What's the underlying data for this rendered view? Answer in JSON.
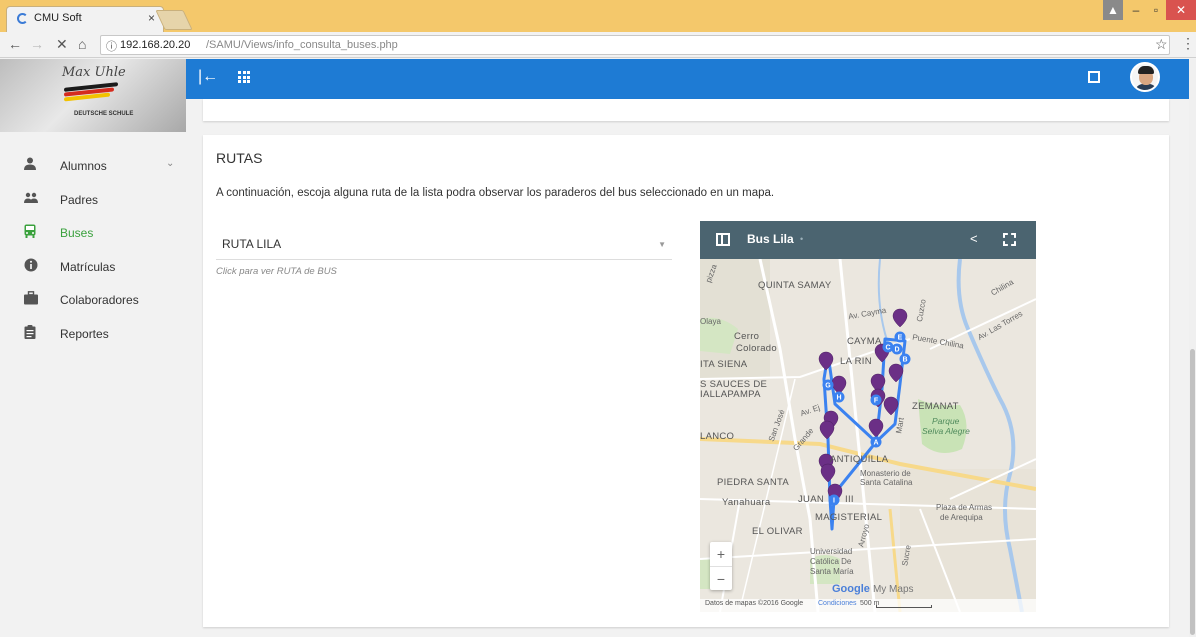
{
  "browser": {
    "tab_title": "CMU Soft",
    "tab_close": "×",
    "url_host": "192.168.20.20",
    "url_path": "/SAMU/Views/info_consulta_buses.php",
    "nav": {
      "back": "←",
      "forward": "→",
      "stop": "✕",
      "home": "⌂"
    },
    "star": "☆",
    "menu": "⋮",
    "window_buttons": {
      "minimize": "–",
      "maximize": "▫",
      "close": "✕"
    }
  },
  "logo": {
    "name": "Max Uhle",
    "subtitle": "DEUTSCHE SCHULE"
  },
  "sidebar": {
    "items": [
      {
        "label": "Alumnos",
        "icon": "person-icon",
        "has_submenu": true
      },
      {
        "label": "Padres",
        "icon": "group-icon"
      },
      {
        "label": "Buses",
        "icon": "bus-icon",
        "active": true
      },
      {
        "label": "Matrículas",
        "icon": "info-icon"
      },
      {
        "label": "Colaboradores",
        "icon": "briefcase-icon"
      },
      {
        "label": "Reportes",
        "icon": "clipboard-icon"
      }
    ],
    "chevron": "⌄"
  },
  "header": {
    "back_icon": "|←",
    "accent_color": "#1e7bd4"
  },
  "content": {
    "title": "RUTAS",
    "description": "A continuación, escoja alguna ruta de la lista podra observar los paraderos del bus seleccionado en un mapa.",
    "route_select": {
      "value": "RUTA LILA",
      "arrow": "▼"
    },
    "hint": "Click para ver RUTA de BUS"
  },
  "map": {
    "title": "Bus Lila",
    "dot": "•",
    "share_icon": "<",
    "labels": {
      "quinta_samay": "QUINTA SAMAY",
      "cerro": "Cerro",
      "colorado": "Colorado",
      "cayma": "CAYMA",
      "la_rinc": "LA RIN",
      "ta_siena": "ITA SIENA",
      "sauces": "S SAUCES DE",
      "allapampa": "IALLAPAMPA",
      "zemanat": "ZEMANAT",
      "parque": "Parque",
      "selva": "Selva Alegre",
      "lanco": "LANCO",
      "antiquilla": "ANTIQUILLA",
      "monasterio": "Monasterio de",
      "santa_catalina": "Santa Catalina",
      "piedra_santa": "PIEDRA SANTA",
      "yanahuara": "Yanahuara",
      "juan": "JUAN",
      "xxiii": "III",
      "magisterial": "MAGISTERIAL",
      "plaza": "Plaza de Armas",
      "arequipa": "de Arequipa",
      "el_olivar": "EL OLIVAR",
      "universidad": "Universidad",
      "catolica": "Católica De",
      "santa_maria": "Santa María",
      "chilina": "Chilina",
      "puente": "Puente Chilina",
      "av_torres": "Av. Las Torres",
      "cayma_av": "Av. Cayma",
      "cuzco": "Cuzco",
      "pizza": "pizza",
      "orlaya": "Olaya",
      "av_ej": "Av. Ej",
      "grande": "Grande",
      "san_jose": "San José",
      "arroyo": "Arroyo",
      "mart": "Mart",
      "sucre": "Sucre"
    },
    "stops": [
      "A",
      "B",
      "C",
      "D",
      "E",
      "F",
      "G",
      "H",
      "I"
    ],
    "zoom_in": "+",
    "zoom_out": "−",
    "google": "Google",
    "my_maps": "My Maps",
    "attribution": "Datos de mapas ©2016 Google",
    "terms": "Condiciones",
    "scale": "500 m",
    "route_color": "#3b82f0",
    "marker_color": "#6b2f86"
  }
}
